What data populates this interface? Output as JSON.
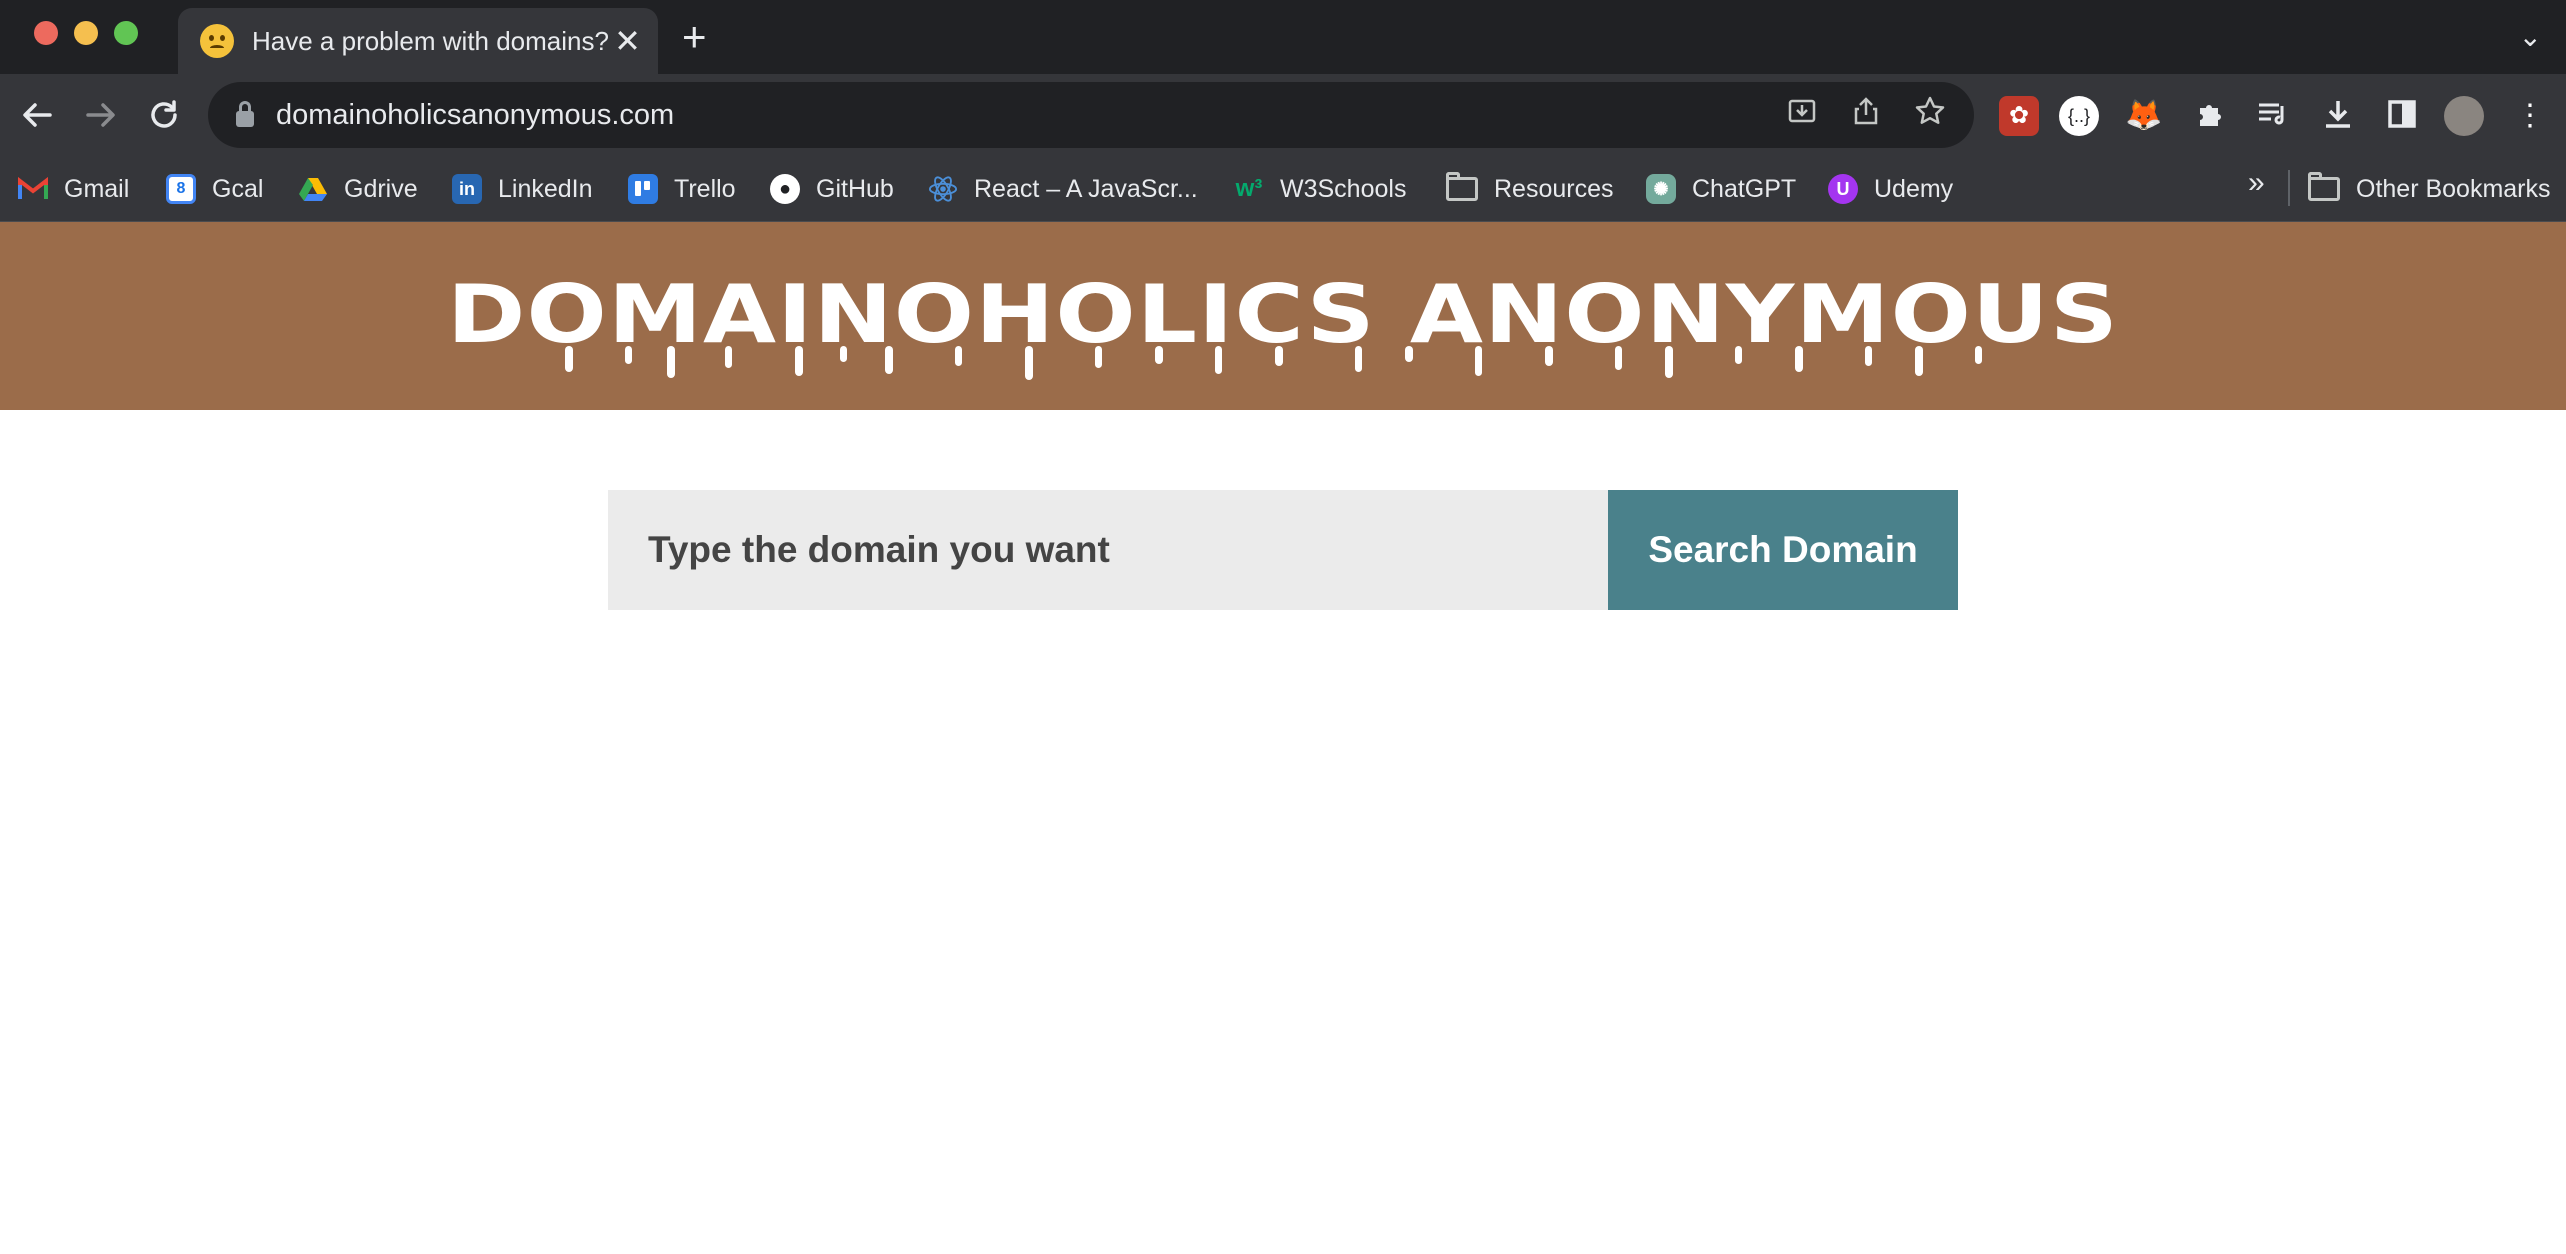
{
  "browser": {
    "tab_title": "Have a problem with domains?",
    "tab_favicon": "worried-face-emoji",
    "url": "domainoholicsanonymous.com"
  },
  "icons": {
    "back": "arrow-left-icon",
    "forward": "arrow-right-icon",
    "reload": "reload-icon",
    "install": "install-app-icon",
    "share": "share-icon",
    "star": "bookmark-star-icon",
    "extensions": "puzzle-icon",
    "reading_list": "reading-list-icon",
    "downloads": "download-icon",
    "side_panel": "side-panel-icon"
  },
  "bookmarks": [
    {
      "label": "Gmail",
      "icon": "gmail-icon"
    },
    {
      "label": "Gcal",
      "icon": "calendar-icon"
    },
    {
      "label": "Gdrive",
      "icon": "drive-icon"
    },
    {
      "label": "LinkedIn",
      "icon": "linkedin-icon"
    },
    {
      "label": "Trello",
      "icon": "trello-icon"
    },
    {
      "label": "GitHub",
      "icon": "github-icon"
    },
    {
      "label": "React – A JavaScr...",
      "icon": "react-icon"
    },
    {
      "label": "W3Schools",
      "icon": "w3schools-icon"
    },
    {
      "label": "Resources",
      "icon": "folder-icon"
    },
    {
      "label": "ChatGPT",
      "icon": "chatgpt-icon"
    },
    {
      "label": "Udemy",
      "icon": "udemy-icon"
    }
  ],
  "other_bookmarks": "Other Bookmarks",
  "site": {
    "title": "DOMAINOHOLICS ANONYMOUS",
    "search_placeholder": "Type the domain you want",
    "search_button": "Search Domain"
  },
  "colors": {
    "header_brown": "#9b6c4a",
    "button_teal": "#4a818b",
    "input_gray": "#ebebeb"
  }
}
